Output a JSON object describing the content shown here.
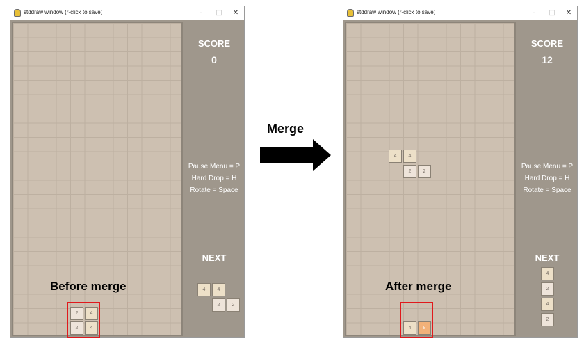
{
  "window": {
    "title": "stddraw window (r-click to save)",
    "controls": {
      "minimize": "–",
      "maximize": "□",
      "close": "✕"
    }
  },
  "left_panel": {
    "score_label": "SCORE",
    "score_value": "0",
    "help": [
      "Pause Menu = P",
      "Hard Drop = H",
      "Rotate = Space"
    ],
    "next_label": "NEXT",
    "board_tiles": [
      "2",
      "4",
      "2",
      "4"
    ],
    "next_tiles": [
      "4",
      "4",
      "2",
      "2"
    ],
    "caption": "Before merge"
  },
  "right_panel": {
    "score_label": "SCORE",
    "score_value": "12",
    "help": [
      "Pause Menu = P",
      "Hard Drop = H",
      "Rotate = Space"
    ],
    "next_label": "NEXT",
    "falling_tiles": [
      "4",
      "4",
      "2",
      "2"
    ],
    "board_tiles": [
      "4",
      "8"
    ],
    "next_tiles": [
      "4",
      "2",
      "4",
      "2"
    ],
    "caption": "After merge"
  },
  "middle": {
    "label": "Merge",
    "arrow_color": "#000000"
  },
  "colors": {
    "board_bg": "#cdc0b1",
    "side_bg": "#9f978c",
    "tile_2": "#eee4da",
    "tile_4": "#ede0c8",
    "tile_8": "#f2b179",
    "highlight_box": "#e0191c"
  }
}
